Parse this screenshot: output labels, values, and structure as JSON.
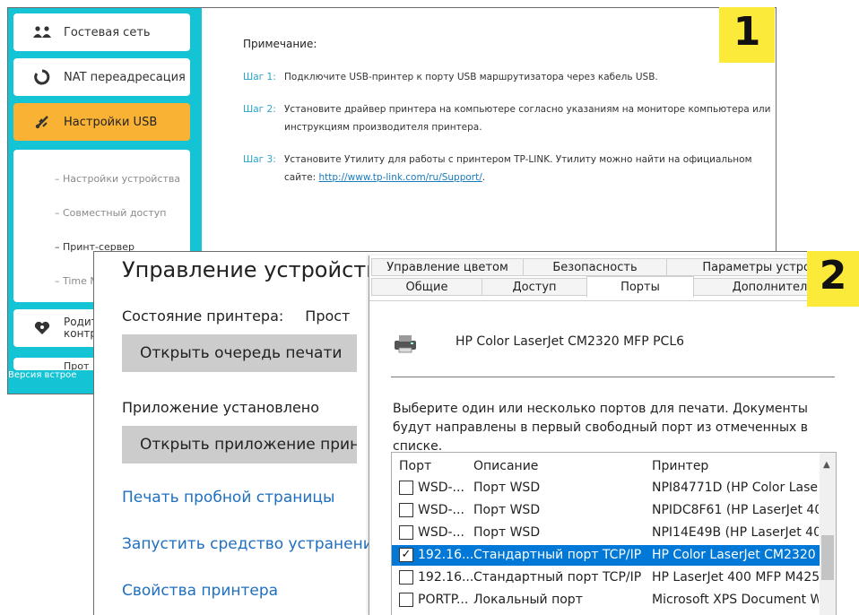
{
  "badges": {
    "one": "1",
    "two": "2"
  },
  "router": {
    "menu": [
      {
        "label": "Гостевая сеть",
        "icon": "guest-network-icon"
      },
      {
        "label": "NAT переадресация",
        "icon": "nat-forwarding-icon"
      },
      {
        "label": "Настройки USB",
        "icon": "usb-icon",
        "active": true
      },
      {
        "label": "Родит контр",
        "icon": "parental-control-icon"
      },
      {
        "label": "Прот",
        "icon": "protocol-icon"
      }
    ],
    "submenu": [
      "Настройки устройства",
      "Совместный доступ",
      "Принт-сервер",
      "Time M"
    ],
    "version": "Версия встрое",
    "note_title": "Примечание:",
    "steps": [
      {
        "label": "Шаг 1:",
        "text": "Подключите USB-принтер к порту USB маршрутизатора через кабель USB."
      },
      {
        "label": "Шаг 2:",
        "text": "Установите драйвер принтера на компьютере согласно указаниям на мониторе компьютера или инструкциям производителя принтера."
      },
      {
        "label": "Шаг 3:",
        "text": "Установите Утилиту для работы с принтером TP-LINK. Утилиту можно найти на официальном сайте: ",
        "link": "http://www.tp-link.com/ru/Support/",
        "after": "."
      }
    ]
  },
  "windows": {
    "title": "Управление устройство",
    "state_label": "Состояние принтера:",
    "state_value": "Прост",
    "open_queue": "Открыть очередь печати",
    "app_installed": "Приложение установлено",
    "open_app": "Открыть приложение принт",
    "links": [
      "Печать пробной страницы",
      "Запустить средство устранения",
      "Свойства принтера"
    ],
    "tabs_top": [
      "Управление цветом",
      "Безопасность",
      "Параметры устройс"
    ],
    "tabs_bottom": [
      "Общие",
      "Доступ",
      "Порты",
      "Дополнительн"
    ],
    "selected_tab": "Порты",
    "printer_name": "HP Color LaserJet CM2320 MFP PCL6",
    "hint": "Выберите один или несколько портов для печати. Документы будут направлены в первый свободный порт из отмеченных в списке.",
    "columns": [
      "Порт",
      "Описание",
      "Принтер"
    ],
    "ports": [
      {
        "port": "WSD-...",
        "desc": "Порт WSD",
        "printer": "NPI84771D (HP Color Lase",
        "checked": false
      },
      {
        "port": "WSD-...",
        "desc": "Порт WSD",
        "printer": "NPIDC8F61 (HP LaserJet 40",
        "checked": false
      },
      {
        "port": "WSD-...",
        "desc": "Порт WSD",
        "printer": "NPI14E49B (HP LaserJet 40",
        "checked": false
      },
      {
        "port": "192.16...",
        "desc": "Стандартный порт TCP/IP",
        "printer": "HP Color LaserJet CM2320",
        "checked": true,
        "selected": true
      },
      {
        "port": "192.16...",
        "desc": "Стандартный порт TCP/IP",
        "printer": "HP LaserJet 400 MFP M425",
        "checked": false
      },
      {
        "port": "PORTP...",
        "desc": "Локальный порт",
        "printer": "Microsoft XPS Document W",
        "checked": false
      }
    ],
    "check_glyph": "✓"
  },
  "colors": {
    "router_sidebar": "#14c3d4",
    "router_active": "#f9b233",
    "badge": "#fcea3a",
    "win_link": "#1f6fbf",
    "win_select": "#0078d7"
  }
}
